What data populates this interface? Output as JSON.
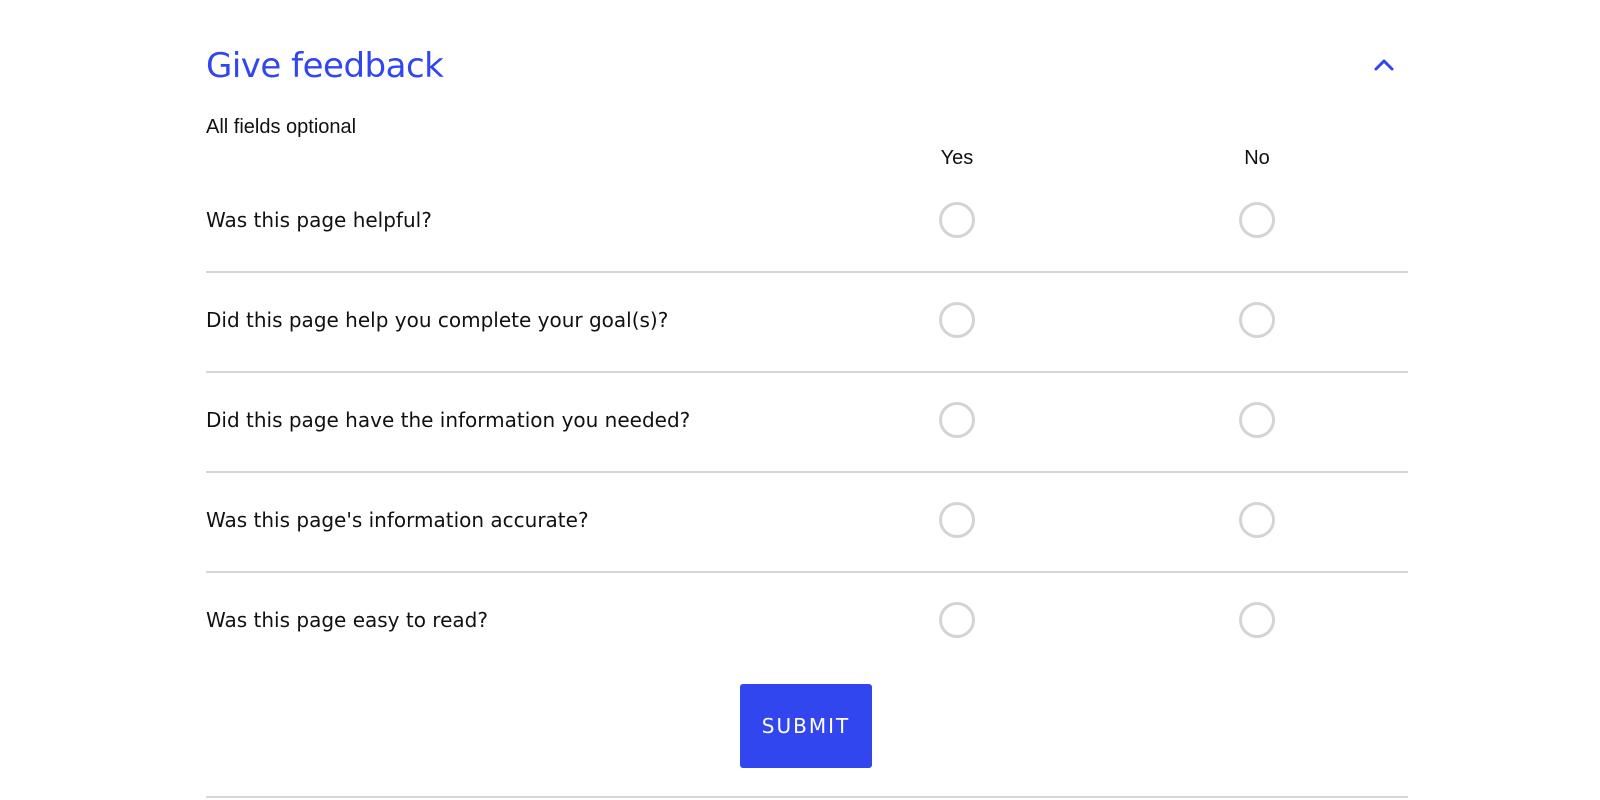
{
  "feedback": {
    "title": "Give feedback",
    "collapse_icon": "chevron-up-icon",
    "subtitle": "All fields optional",
    "columns": {
      "yes": "Yes",
      "no": "No"
    },
    "questions": [
      {
        "label": "Was this page helpful?",
        "selected": null
      },
      {
        "label": "Did this page help you complete your goal(s)?",
        "selected": null
      },
      {
        "label": "Did this page have the information you needed?",
        "selected": null
      },
      {
        "label": "Was this page's information accurate?",
        "selected": null
      },
      {
        "label": "Was this page easy to read?",
        "selected": null
      }
    ],
    "submit_label": "SUBMIT"
  },
  "colors": {
    "accent": "#3246f0",
    "divider": "#d6d6d6",
    "radio_border": "#d4d4d4"
  }
}
